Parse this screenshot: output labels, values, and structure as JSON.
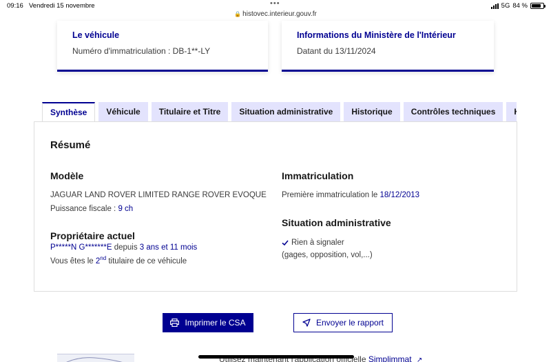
{
  "statusbar": {
    "time": "09:16",
    "date": "Vendredi 15 novembre",
    "url": "histovec.interieur.gouv.fr",
    "network": "5G",
    "battery": "84 %",
    "battery_level": 0.84
  },
  "cards": {
    "vehicle": {
      "title": "Le véhicule",
      "text": "Numéro d'immatriculation : DB-1**-LY"
    },
    "ministry": {
      "title": "Informations du Ministère de l'Intérieur",
      "text": "Datant du 13/11/2024"
    }
  },
  "tabs": [
    "Synthèse",
    "Véhicule",
    "Titulaire et Titre",
    "Situation administrative",
    "Historique",
    "Contrôles techniques",
    "Kilométrage"
  ],
  "summary": {
    "title": "Résumé",
    "model": {
      "heading": "Modèle",
      "name": "JAGUAR LAND ROVER LIMITED RANGE ROVER EVOQUE",
      "power_label": "Puissance fiscale : ",
      "power_value": "9 ch"
    },
    "owner": {
      "heading": "Propriétaire actuel",
      "name": "P*****N G*******E",
      "since_label": " depuis ",
      "since_value": "3 ans et 11 mois",
      "rank_prefix": "Vous êtes le ",
      "rank_number": "2",
      "rank_sup": "nd",
      "rank_suffix": " titulaire de ce véhicule"
    },
    "registration": {
      "heading": "Immatriculation",
      "first_label": "Première immatriculation le ",
      "first_value": "18/12/2013"
    },
    "admin": {
      "heading": "Situation administrative",
      "status": "Rien à signaler",
      "detail": "(gages, opposition, vol,...)"
    }
  },
  "actions": {
    "print": "Imprimer le CSA",
    "send": "Envoyer le rapport"
  },
  "footer": {
    "text_prefix": "Utilisez maintenant l'application officielle ",
    "link": "Simplimmat"
  },
  "colors": {
    "primary": "#000091",
    "tab_bg": "#e3e3fd"
  }
}
